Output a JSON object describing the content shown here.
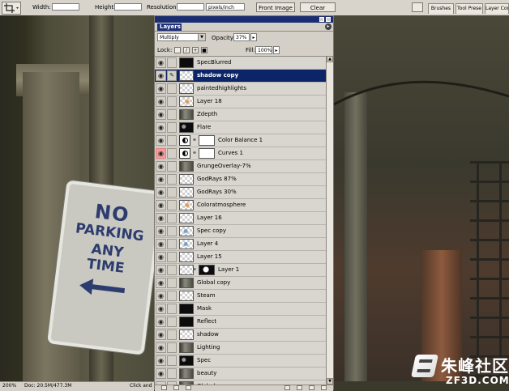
{
  "options_bar": {
    "width_label": "Width:",
    "height_label": "Height:",
    "resolution_label": "Resolution:",
    "resolution_unit": "pixels/inch",
    "front_image_label": "Front Image",
    "clear_label": "Clear"
  },
  "palette_well": {
    "tabs": [
      "Brushes",
      "Tool Prese",
      "Layer Con"
    ]
  },
  "layers_panel": {
    "tab_label": "Layers",
    "blend_mode": "Multiply",
    "opacity_label": "Opacity:",
    "opacity_value": "37%",
    "lock_label": "Lock:",
    "fill_label": "Fill:",
    "fill_value": "100%",
    "layers": [
      {
        "name": "SpecBlurred",
        "thumb": "dark"
      },
      {
        "name": "shadow copy",
        "thumb": "checker",
        "selected": true
      },
      {
        "name": "paintedhighlights",
        "thumb": "checker"
      },
      {
        "name": "Layer 18",
        "thumb": "checker-orange"
      },
      {
        "name": "Zdepth",
        "thumb": "photo"
      },
      {
        "name": "Flare",
        "thumb": "dark-spots"
      },
      {
        "name": "Color Balance 1",
        "thumb": "adjustment"
      },
      {
        "name": "Curves 1",
        "thumb": "adjustment",
        "eye_highlight": true
      },
      {
        "name": "GrungeOverlay-7%",
        "thumb": "photo"
      },
      {
        "name": "GodRays 87%",
        "thumb": "checker"
      },
      {
        "name": "GodRays 30%",
        "thumb": "checker"
      },
      {
        "name": "Coloratmosphere",
        "thumb": "checker-orange"
      },
      {
        "name": "Layer 16",
        "thumb": "checker"
      },
      {
        "name": "Spec copy",
        "thumb": "checker-blue"
      },
      {
        "name": "Layer 4",
        "thumb": "checker-blue"
      },
      {
        "name": "Layer 15",
        "thumb": "checker"
      },
      {
        "name": "Layer 1",
        "thumb": "checker",
        "mask": "dark"
      },
      {
        "name": "Global copy",
        "thumb": "photo"
      },
      {
        "name": "Steam",
        "thumb": "checker"
      },
      {
        "name": "Mask",
        "thumb": "dark"
      },
      {
        "name": "Reflect",
        "thumb": "dark"
      },
      {
        "name": "shadow",
        "thumb": "checker"
      },
      {
        "name": "Lighting",
        "thumb": "photo"
      },
      {
        "name": "Spec",
        "thumb": "dark-spots"
      },
      {
        "name": "beauty",
        "thumb": "photo"
      },
      {
        "name": "Global",
        "thumb": "photo"
      }
    ]
  },
  "canvas": {
    "sign_lines": [
      "NO",
      "PARKING",
      "ANY",
      "TIME"
    ]
  },
  "status_bar": {
    "zoom": "200%",
    "doc_info": "Doc: 20.5M/477.3M",
    "hint": "Click and"
  },
  "watermark": {
    "chinese_text": "朱峰社区",
    "latin_text": "ZF3D.COM"
  },
  "colors": {
    "selection_blue": "#0c2468",
    "panel_gray": "#d4d0c8",
    "curves_eye_highlight": "#f19b9b"
  }
}
